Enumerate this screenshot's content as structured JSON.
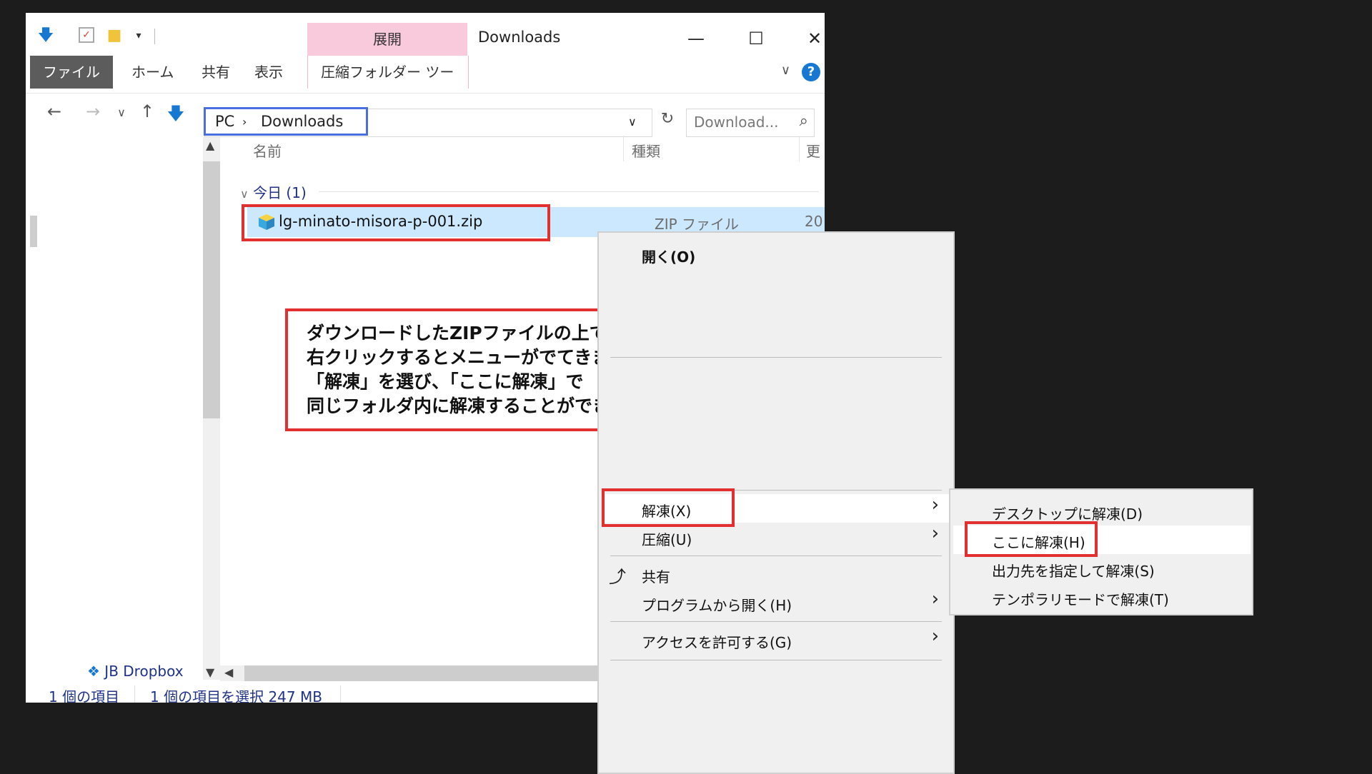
{
  "window": {
    "title": "Downloads",
    "context_tab_header": "展開",
    "ribbon_tabs": [
      "ファイル",
      "ホーム",
      "共有",
      "表示",
      "圧縮フォルダー ツール"
    ]
  },
  "nav": {
    "breadcrumb": [
      "PC",
      "Downloads"
    ],
    "search_placeholder": "Download..."
  },
  "columns": {
    "name": "名前",
    "type": "種類",
    "date": "更"
  },
  "group": {
    "label": "今日 (1)"
  },
  "file": {
    "name": "lg-minato-misora-p-001.zip",
    "type": "ZIP ファイル",
    "date": "20"
  },
  "note": {
    "lines": [
      "ダウンロードしたZIPファイルの上で",
      "右クリックするとメニューがでてきます。",
      "「解凍」を選び、「ここに解凍」で",
      "同じフォルダ内に解凍することができます。"
    ]
  },
  "left_pane": {
    "item": "JB Dropbox"
  },
  "status": {
    "count": "1 個の項目",
    "selected": "1 個の項目を選択  247 MB"
  },
  "context_menu": {
    "open": "開く(O)",
    "extract": "解凍(X)",
    "compress": "圧縮(U)",
    "share": "共有",
    "open_with": "プログラムから開く(H)",
    "give_access": "アクセスを許可する(G)"
  },
  "submenu": {
    "items": [
      "デスクトップに解凍(D)",
      "ここに解凍(H)",
      "出力先を指定して解凍(S)",
      "テンポラリモードで解凍(T)"
    ]
  },
  "colors": {
    "highlight_red": "#e23030",
    "address_highlight_blue": "#4a6fe3",
    "selection_blue": "#cce8ff",
    "context_tab_pink": "#f9c9dc"
  }
}
